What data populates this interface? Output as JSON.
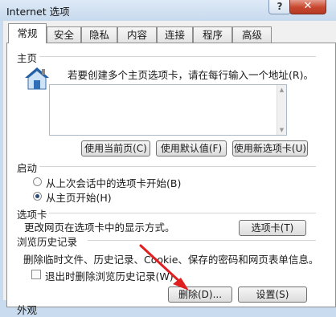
{
  "window": {
    "title": "Internet 选项",
    "help_label": "?",
    "close_label": "✕"
  },
  "tabs": [
    {
      "label": "常规",
      "active": true
    },
    {
      "label": "安全"
    },
    {
      "label": "隐私"
    },
    {
      "label": "内容"
    },
    {
      "label": "连接"
    },
    {
      "label": "程序"
    },
    {
      "label": "高级"
    }
  ],
  "home_page": {
    "heading": "主页",
    "icon": "home-icon",
    "instruction": "若要创建多个主页选项卡，请在每行输入一个地址(R)。",
    "url_value": "",
    "use_current_label": "使用当前页(C)",
    "use_default_label": "使用默认值(F)",
    "use_new_tab_label": "使用新选项卡(U)"
  },
  "startup": {
    "heading": "启动",
    "option_last_session": "从上次会话中的选项卡开始(B)",
    "option_home_page": "从主页开始(H)",
    "selected": "home_page"
  },
  "tabs_section": {
    "heading": "选项卡",
    "description": "更改网页在选项卡中的显示方式。",
    "tabs_button_label": "选项卡(T)"
  },
  "browsing_history": {
    "heading": "浏览历史记录",
    "description": "删除临时文件、历史记录、Cookie、保存的密码和网页表单信息。",
    "delete_on_exit_label": "退出时删除浏览历史记录(W)",
    "delete_on_exit_checked": false,
    "delete_label": "删除(D)...",
    "settings_label": "设置(S)"
  },
  "appearance": {
    "heading": "外观"
  },
  "colors": {
    "annotation_arrow": "#e02020"
  }
}
